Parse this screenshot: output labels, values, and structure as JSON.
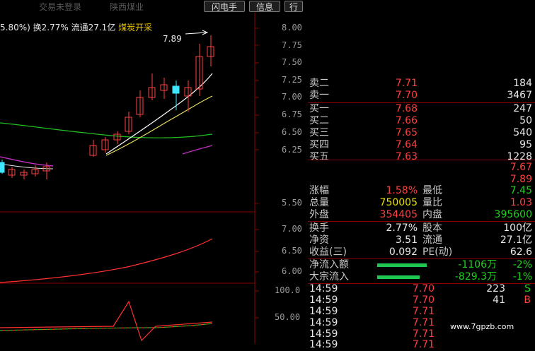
{
  "topbar": {
    "title": "交易未登录",
    "stock_name": "陕西煤业",
    "tabs": [
      "闪电手",
      "信息",
      "行"
    ]
  },
  "info_bar": {
    "change_pct": "5.80%)",
    "turnover": "换2.77%",
    "float_cap": "流通27.1亿",
    "sector": "煤炭开采"
  },
  "main_chart": {
    "y_ticks": [
      "8.00",
      "7.75",
      "7.50",
      "7.25",
      "7.00",
      "6.75",
      "6.50",
      "6.25",
      "5.50"
    ],
    "high_marker": "7.89"
  },
  "sub_chart1": {
    "y_ticks": [
      "7.00",
      "6.50",
      "6.00"
    ]
  },
  "sub_chart2": {
    "y_ticks": [
      "100.0",
      "50.00"
    ]
  },
  "order_book": {
    "asks": [
      {
        "label": "卖二",
        "price": "7.71",
        "vol": "184"
      },
      {
        "label": "卖一",
        "price": "7.70",
        "vol": "3467"
      }
    ],
    "bids": [
      {
        "label": "买一",
        "price": "7.68",
        "vol": "247"
      },
      {
        "label": "买二",
        "price": "7.66",
        "vol": "50"
      },
      {
        "label": "买三",
        "price": "7.65",
        "vol": "540"
      },
      {
        "label": "买四",
        "price": "7.64",
        "vol": "95"
      },
      {
        "label": "买五",
        "price": "7.63",
        "vol": "1228"
      }
    ]
  },
  "quote": {
    "open": "7.67",
    "high": "7.89",
    "change_pct_label": "涨幅",
    "change_pct": "1.58%",
    "low_label": "最低",
    "low": "7.45",
    "volume_label": "总量",
    "volume": "750005",
    "vol_ratio_label": "量比",
    "vol_ratio": "1.03",
    "outer_label": "外盘",
    "outer": "354405",
    "inner_label": "内盘",
    "inner": "395600",
    "turnover_label": "换手",
    "turnover": "2.77%",
    "share_cap_label": "股本",
    "share_cap": "100亿",
    "net_asset_label": "净资",
    "net_asset": "3.51",
    "float_label": "流通",
    "float": "27.1亿",
    "eps_label": "收益(三)",
    "eps": "0.092",
    "pe_label": "PE(动)",
    "pe": "62.6"
  },
  "fund_flow": [
    {
      "label": "净流入额",
      "amount": "-1106万",
      "pct": "-2%"
    },
    {
      "label": "大宗流入",
      "amount": "-829.3万",
      "pct": "-1%"
    }
  ],
  "ticks": [
    {
      "time": "14:59",
      "price": "7.70",
      "vol": "223",
      "side": "S"
    },
    {
      "time": "14:59",
      "price": "7.70",
      "vol": "41",
      "side": "B"
    },
    {
      "time": "14:59",
      "price": "7.71",
      "vol": "",
      "side": ""
    },
    {
      "time": "14:59",
      "price": "7.71",
      "vol": "",
      "side": ""
    },
    {
      "time": "14:59",
      "price": "7.71",
      "vol": "",
      "side": ""
    },
    {
      "time": "14:59",
      "price": "7.71",
      "vol": "",
      "side": ""
    }
  ],
  "watermark": "www.7gpzb.com",
  "colors": {
    "up": "#ff4040",
    "down": "#3ee6ff",
    "ma5": "#ffffff",
    "ma10": "#e8e060",
    "ma20": "#20c020",
    "ma30": "#c030c0",
    "grid": "#8a0000"
  }
}
